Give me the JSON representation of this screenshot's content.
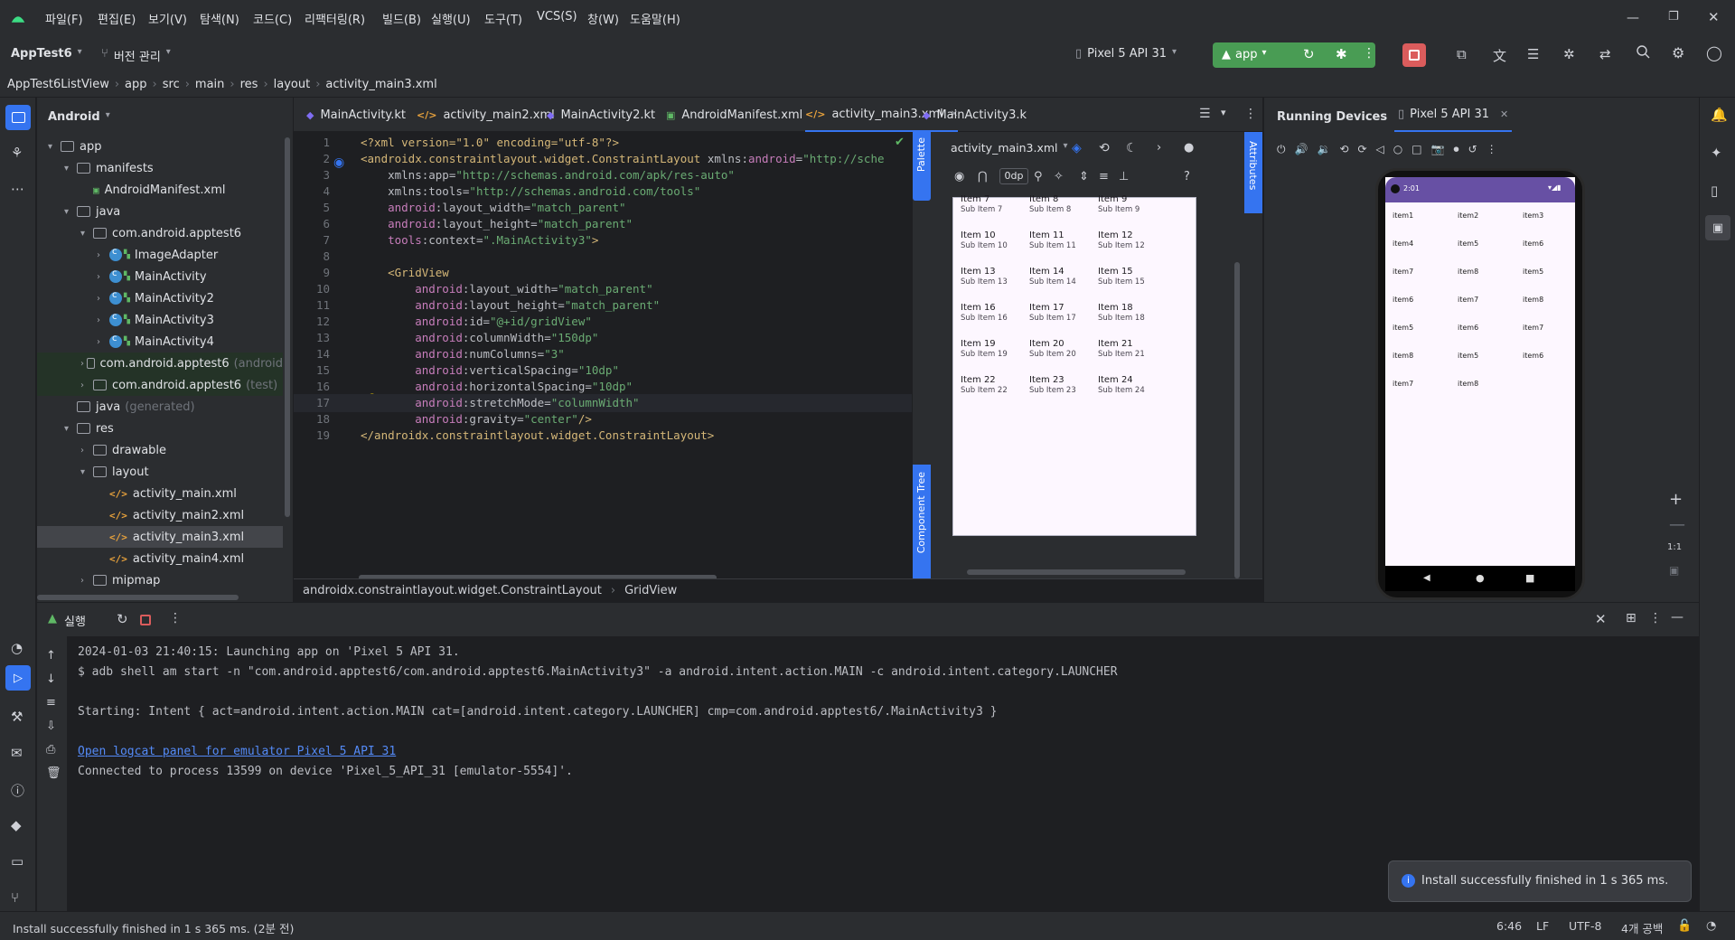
{
  "menu": [
    "파일(F)",
    "편집(E)",
    "보기(V)",
    "탐색(N)",
    "코드(C)",
    "리팩터링(R)",
    "빌드(B)",
    "실행(U)",
    "도구(T)",
    "VCS(S)",
    "창(W)",
    "도움말(H)"
  ],
  "toolbar": {
    "project": "AppTest6",
    "vcs": "버전 관리",
    "device": "Pixel 5 API 31",
    "run_config": "app"
  },
  "nav": [
    "AppTest6ListView",
    "app",
    "src",
    "main",
    "res",
    "layout",
    "activity_main3.xml"
  ],
  "project_view": "Android",
  "tree": [
    {
      "label": "app",
      "indent": 0,
      "arrow": "▾",
      "type": "folder"
    },
    {
      "label": "manifests",
      "indent": 1,
      "arrow": "▾",
      "type": "folder"
    },
    {
      "label": "AndroidManifest.xml",
      "indent": 2,
      "arrow": "",
      "type": "manifest"
    },
    {
      "label": "java",
      "indent": 1,
      "arrow": "▾",
      "type": "folder"
    },
    {
      "label": "com.android.apptest6",
      "indent": 2,
      "arrow": "▾",
      "type": "folder"
    },
    {
      "label": "ImageAdapter",
      "indent": 3,
      "arrow": "›",
      "type": "class"
    },
    {
      "label": "MainActivity",
      "indent": 3,
      "arrow": "›",
      "type": "class"
    },
    {
      "label": "MainActivity2",
      "indent": 3,
      "arrow": "›",
      "type": "class"
    },
    {
      "label": "MainActivity3",
      "indent": 3,
      "arrow": "›",
      "type": "class"
    },
    {
      "label": "MainActivity4",
      "indent": 3,
      "arrow": "›",
      "type": "class"
    },
    {
      "label": "com.android.apptest6",
      "suffix": "(android",
      "indent": 2,
      "arrow": "›",
      "type": "folder",
      "green": true
    },
    {
      "label": "com.android.apptest6",
      "suffix": "(test)",
      "indent": 2,
      "arrow": "›",
      "type": "folder",
      "green": true
    },
    {
      "label": "java",
      "suffix": "(generated)",
      "indent": 1,
      "arrow": "",
      "type": "folder"
    },
    {
      "label": "res",
      "indent": 1,
      "arrow": "▾",
      "type": "folder"
    },
    {
      "label": "drawable",
      "indent": 2,
      "arrow": "›",
      "type": "folder"
    },
    {
      "label": "layout",
      "indent": 2,
      "arrow": "▾",
      "type": "folder"
    },
    {
      "label": "activity_main.xml",
      "indent": 3,
      "arrow": "",
      "type": "xml"
    },
    {
      "label": "activity_main2.xml",
      "indent": 3,
      "arrow": "",
      "type": "xml"
    },
    {
      "label": "activity_main3.xml",
      "indent": 3,
      "arrow": "",
      "type": "xml",
      "selected": true
    },
    {
      "label": "activity_main4.xml",
      "indent": 3,
      "arrow": "",
      "type": "xml"
    },
    {
      "label": "mipmap",
      "indent": 2,
      "arrow": "›",
      "type": "folder"
    }
  ],
  "tabs": [
    {
      "label": "MainActivity.kt",
      "type": "kt"
    },
    {
      "label": "activity_main2.xml",
      "type": "xml"
    },
    {
      "label": "MainActivity2.kt",
      "type": "kt"
    },
    {
      "label": "AndroidManifest.xml",
      "type": "manifest"
    },
    {
      "label": "activity_main3.xml",
      "type": "xml",
      "active": true
    },
    {
      "label": "MainActivity3.k",
      "type": "kt"
    }
  ],
  "code": [
    [
      [
        "t",
        "<?xml version=\"1.0\" encoding=\"utf-8\"?>"
      ]
    ],
    [
      [
        "t",
        "<androidx.constraintlayout.widget.ConstraintLayout "
      ],
      [
        "a",
        "xmlns:"
      ],
      [
        "ns",
        "android"
      ],
      [
        "a",
        "="
      ],
      [
        "v",
        "\"http://sche"
      ]
    ],
    [
      [
        "a",
        "    xmlns:app="
      ],
      [
        "v",
        "\"http://schemas.android.com/apk/res-auto\""
      ]
    ],
    [
      [
        "a",
        "    xmlns:tools="
      ],
      [
        "v",
        "\"http://schemas.android.com/tools\""
      ]
    ],
    [
      [
        "ns",
        "    android"
      ],
      [
        "a",
        ":layout_width="
      ],
      [
        "v",
        "\"match_parent\""
      ]
    ],
    [
      [
        "ns",
        "    android"
      ],
      [
        "a",
        ":layout_height="
      ],
      [
        "v",
        "\"match_parent\""
      ]
    ],
    [
      [
        "ns",
        "    tools"
      ],
      [
        "a",
        ":context="
      ],
      [
        "v",
        "\".MainActivity3\""
      ],
      [
        "t",
        ">"
      ]
    ],
    [
      [
        "a",
        ""
      ]
    ],
    [
      [
        "t",
        "    <GridView"
      ]
    ],
    [
      [
        "ns",
        "        android"
      ],
      [
        "a",
        ":layout_width="
      ],
      [
        "v",
        "\"match_parent\""
      ]
    ],
    [
      [
        "ns",
        "        android"
      ],
      [
        "a",
        ":layout_height="
      ],
      [
        "v",
        "\"match_parent\""
      ]
    ],
    [
      [
        "ns",
        "        android"
      ],
      [
        "a",
        ":id="
      ],
      [
        "v",
        "\"@+id/gridView\""
      ]
    ],
    [
      [
        "ns",
        "        android"
      ],
      [
        "a",
        ":columnWidth="
      ],
      [
        "v",
        "\"150dp\""
      ]
    ],
    [
      [
        "ns",
        "        android"
      ],
      [
        "a",
        ":numColumns="
      ],
      [
        "v",
        "\"3\""
      ]
    ],
    [
      [
        "ns",
        "        android"
      ],
      [
        "a",
        ":verticalSpacing="
      ],
      [
        "v",
        "\"10dp\""
      ]
    ],
    [
      [
        "ns",
        "        android"
      ],
      [
        "a",
        ":horizontalSpacing="
      ],
      [
        "v",
        "\"10dp\""
      ]
    ],
    [
      [
        "ns",
        "        android"
      ],
      [
        "a",
        ":stretchMode="
      ],
      [
        "v",
        "\"columnWidth\""
      ]
    ],
    [
      [
        "ns",
        "        android"
      ],
      [
        "a",
        ":gravity="
      ],
      [
        "v",
        "\"center\""
      ],
      [
        "t",
        "/>"
      ]
    ],
    [
      [
        "t",
        "</androidx.constraintlayout.widget.ConstraintLayout>"
      ]
    ]
  ],
  "design": {
    "file": "activity_main3.xml",
    "palette": "Palette",
    "component_tree": "Component Tree",
    "attributes": "Attributes",
    "margin": "0dp",
    "grid_items": [
      [
        "Item 7",
        "Sub Item 7"
      ],
      [
        "Item 8",
        "Sub Item 8"
      ],
      [
        "Item 9",
        "Sub Item 9"
      ],
      [
        "Item 10",
        "Sub Item 10"
      ],
      [
        "Item 11",
        "Sub Item 11"
      ],
      [
        "Item 12",
        "Sub Item 12"
      ],
      [
        "Item 13",
        "Sub Item 13"
      ],
      [
        "Item 14",
        "Sub Item 14"
      ],
      [
        "Item 15",
        "Sub Item 15"
      ],
      [
        "Item 16",
        "Sub Item 16"
      ],
      [
        "Item 17",
        "Sub Item 17"
      ],
      [
        "Item 18",
        "Sub Item 18"
      ],
      [
        "Item 19",
        "Sub Item 19"
      ],
      [
        "Item 20",
        "Sub Item 20"
      ],
      [
        "Item 21",
        "Sub Item 21"
      ],
      [
        "Item 22",
        "Sub Item 22"
      ],
      [
        "Item 23",
        "Sub Item 23"
      ],
      [
        "Item 24",
        "Sub Item 24"
      ]
    ]
  },
  "breadcrumb2": [
    "androidx.constraintlayout.widget.ConstraintLayout",
    "GridView"
  ],
  "running": {
    "title": "Running Devices",
    "device_tab": "Pixel 5 API 31",
    "clock": "2:01",
    "phone_items": [
      "item1",
      "item2",
      "item3",
      "item4",
      "item5",
      "item6",
      "item7",
      "item8",
      "item5",
      "item6",
      "item7",
      "item8",
      "item5",
      "item6",
      "item7",
      "item8",
      "item5",
      "item6",
      "item7",
      "item8"
    ],
    "zoom_label": "1:1"
  },
  "run_tab": "실행",
  "console": [
    {
      "text": "2024-01-03 21:40:15: Launching app on 'Pixel 5 API 31."
    },
    {
      "text": "$ adb shell am start -n \"com.android.apptest6/com.android.apptest6.MainActivity3\" -a android.intent.action.MAIN -c android.intent.category.LAUNCHER"
    },
    {
      "text": ""
    },
    {
      "text": "Starting: Intent { act=android.intent.action.MAIN cat=[android.intent.category.LAUNCHER] cmp=com.android.apptest6/.MainActivity3 }"
    },
    {
      "text": ""
    },
    {
      "text": "Open logcat panel for emulator Pixel 5 API 31",
      "link": true
    },
    {
      "text": "Connected to process 13599 on device 'Pixel_5_API_31 [emulator-5554]'."
    }
  ],
  "toast": "Install successfully finished in 1 s 365 ms.",
  "status": {
    "message": "Install successfully finished in 1 s 365 ms. (2분 전)",
    "position": "6:46",
    "line_sep": "LF",
    "encoding": "UTF-8",
    "indent": "4개 공백"
  },
  "colors": {
    "accent": "#3574f0",
    "run_green": "#499c54",
    "stop_red": "#db5c5c",
    "phone_primary": "#6750a4"
  }
}
